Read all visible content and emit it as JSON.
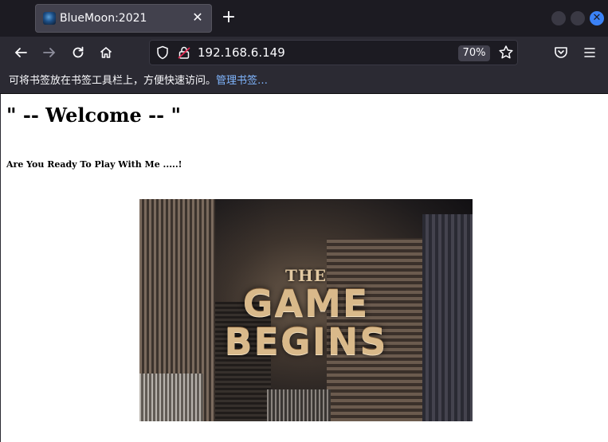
{
  "browser": {
    "tab": {
      "title": "BlueMoon:2021",
      "close_glyph": "✕"
    },
    "new_tab_glyph": "+",
    "url": "192.168.6.149",
    "zoom": "70%",
    "bookmarks_bar": {
      "message": "可将书签放在书签工具栏上，方便快速访问。",
      "link": "管理书签…"
    },
    "icons": [
      "back-icon",
      "forward-icon",
      "reload-icon",
      "home-icon",
      "shield-icon",
      "insecure-lock-icon",
      "star-icon",
      "pocket-icon",
      "menu-icon"
    ]
  },
  "page": {
    "heading": "\" -- Welcome -- \"",
    "subheading": "Are You Ready To Play With Me .....!",
    "hero_image": {
      "text_line1": "THE",
      "text_line2": "GAME",
      "text_line3": "BEGINS"
    }
  }
}
